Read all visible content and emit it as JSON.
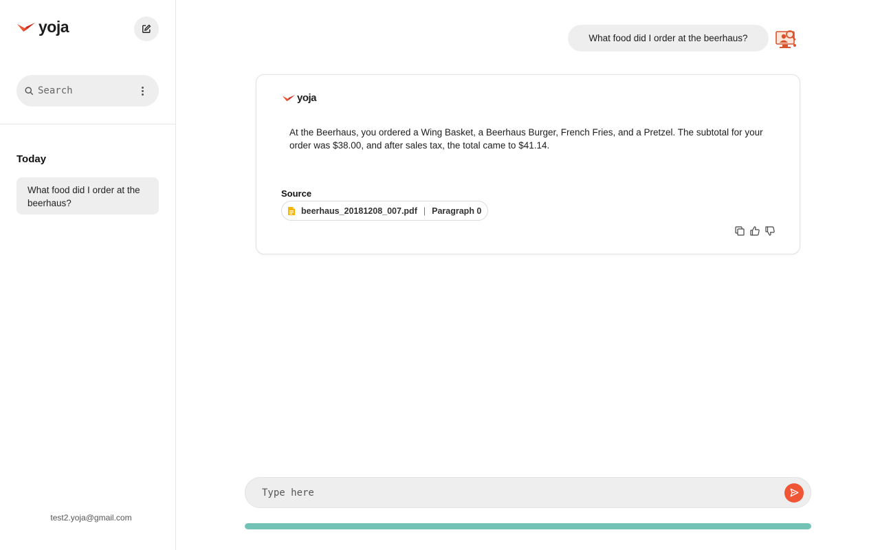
{
  "brand": {
    "name": "yoja",
    "logo_icon": "bird-logo-icon",
    "accent": "#f05535"
  },
  "sidebar": {
    "new_chat_icon": "edit-icon",
    "search": {
      "placeholder": "Search",
      "value": ""
    },
    "section_title": "Today",
    "history": [
      {
        "label": "What food did I order at the beerhaus?"
      }
    ],
    "user_email": "test2.yoja@gmail.com"
  },
  "chat": {
    "user_message": "What food did I order at the beerhaus?",
    "answer": {
      "text": "At the Beerhaus, you ordered a Wing Basket, a Beerhaus Burger, French Fries, and a Pretzel. The subtotal for your order was $38.00, and after sales tax, the total came to $41.14.",
      "source_label": "Source",
      "source": {
        "file": "beerhaus_20181208_007.pdf",
        "separator": "|",
        "location": "Paragraph 0"
      },
      "actions": [
        "copy-icon",
        "thumbs-up-icon",
        "thumbs-down-icon"
      ]
    }
  },
  "composer": {
    "placeholder": "Type here",
    "value": "",
    "progress": 1.0,
    "progress_color": "#72c2b6"
  }
}
